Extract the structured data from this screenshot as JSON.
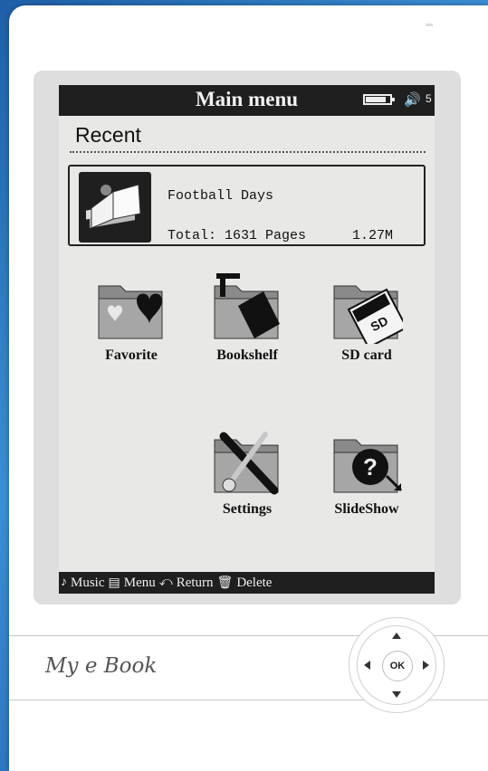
{
  "screen": {
    "title": "Main menu",
    "battery_level": 0.85,
    "volume_level": "5"
  },
  "recent": {
    "heading": "Recent",
    "book_title": "Football Days",
    "total_pages": "Total: 1631 Pages",
    "file_size": "1.27M"
  },
  "menu": {
    "favorite": "Favorite",
    "bookshelf": "Bookshelf",
    "sd_card": "SD card",
    "settings": "Settings",
    "slideshow": "SlideShow"
  },
  "bottom_bar": {
    "music": "Music",
    "menu": "Menu",
    "return": "Return",
    "delete": "Delete"
  },
  "device": {
    "brand": "My e Book",
    "ok_label": "OK"
  },
  "icons": {
    "favorite": "heart-folder-icon",
    "bookshelf": "book-folder-icon",
    "sd_card": "sd-card-folder-icon",
    "settings": "tools-folder-icon",
    "slideshow": "help-folder-icon"
  }
}
